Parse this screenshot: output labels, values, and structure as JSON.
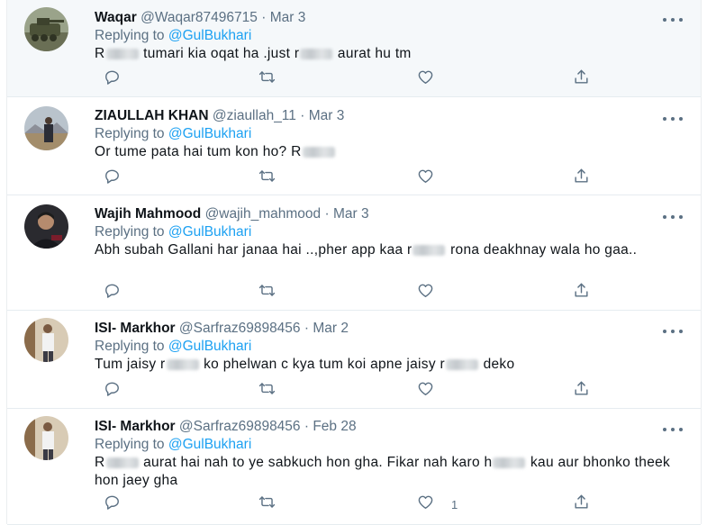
{
  "tweets": [
    {
      "name": "Waqar",
      "handle": "@Waqar87496715",
      "date": "Mar 3",
      "replying_prefix": "Replying to",
      "replying_to": "@GulBukhari",
      "body": [
        {
          "t": "R"
        },
        {
          "blur": "andi"
        },
        {
          "t": " tumari kia oqat ha .just r"
        },
        {
          "blur": "andi"
        },
        {
          "t": " aurat hu tm"
        }
      ],
      "like_count": ""
    },
    {
      "name": "ZIAULLAH KHAN",
      "handle": "@ziaullah_11",
      "date": "Mar 3",
      "replying_prefix": "Replying to",
      "replying_to": "@GulBukhari",
      "body": [
        {
          "t": "Or tume pata hai tum kon ho? R"
        },
        {
          "blur": "ANDI"
        }
      ],
      "like_count": ""
    },
    {
      "name": "Wajih Mahmood",
      "handle": "@wajih_mahmood",
      "date": "Mar 3",
      "replying_prefix": "Replying to",
      "replying_to": "@GulBukhari",
      "body": [
        {
          "t": "Abh subah Gallani  har janaa hai ..,pher app kaa r"
        },
        {
          "blur": "andi"
        },
        {
          "t": " rona deakhnay wala ho gaa.."
        }
      ],
      "like_count": ""
    },
    {
      "name": "ISI- Markhor",
      "handle": "@Sarfraz69898456",
      "date": "Mar 2",
      "replying_prefix": "Replying to",
      "replying_to": "@GulBukhari",
      "body": [
        {
          "t": "Tum jaisy r"
        },
        {
          "blur": "andi"
        },
        {
          "t": " ko phelwan c kya tum koi apne jaisy r"
        },
        {
          "blur": "andi"
        },
        {
          "t": " deko"
        }
      ],
      "like_count": ""
    },
    {
      "name": "ISI- Markhor",
      "handle": "@Sarfraz69898456",
      "date": "Feb 28",
      "replying_prefix": "Replying to",
      "replying_to": "@GulBukhari",
      "body": [
        {
          "t": "R"
        },
        {
          "blur": "andi"
        },
        {
          "t": " aurat hai nah to ye sabkuch hon gha. Fikar nah karo h"
        },
        {
          "blur": "aram"
        },
        {
          "t": " kau aur bhonko theek hon jaey gha"
        }
      ],
      "like_count": "1"
    }
  ],
  "icons": {
    "reply": "reply-icon",
    "retweet": "retweet-icon",
    "like": "heart-icon",
    "share": "share-icon",
    "more": "more-icon"
  },
  "colors": {
    "text": "#0f1419",
    "secondary": "#5b7083",
    "link": "#1da1f2",
    "highlight_bg": "#f5f8fa",
    "divider": "#e6ecf0"
  },
  "separator": "·"
}
